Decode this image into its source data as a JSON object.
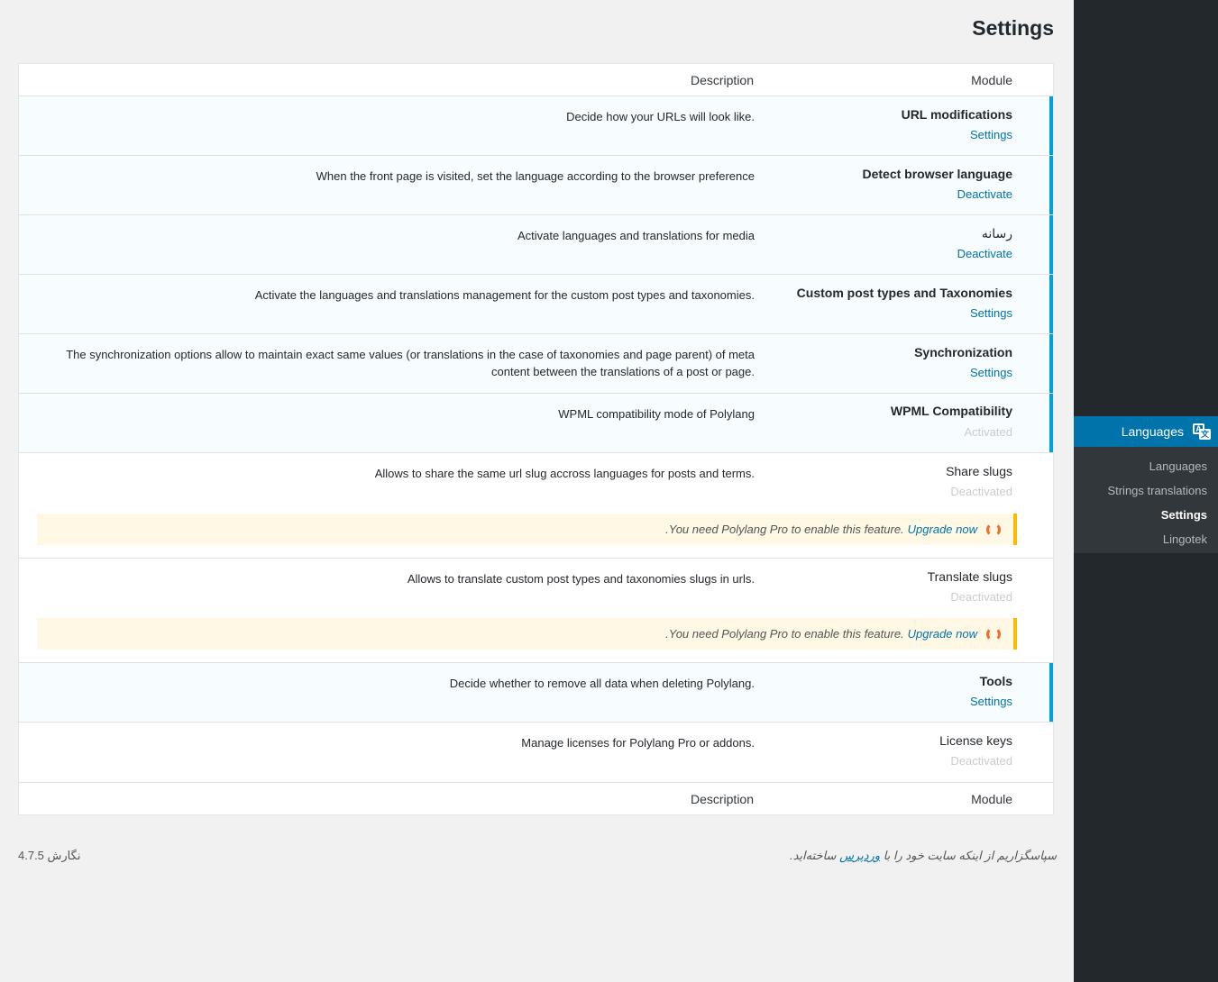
{
  "page": {
    "title": "Settings"
  },
  "table": {
    "header": {
      "module": "Module",
      "description": "Description"
    },
    "rows": [
      {
        "name": "URL modifications",
        "action": "Settings",
        "description": ".Decide how your URLs will look like",
        "active": true
      },
      {
        "name": "Detect browser language",
        "action": "Deactivate",
        "description": "When the front page is visited, set the language according to the browser preference",
        "active": true
      },
      {
        "name": "رسانه",
        "action": "Deactivate",
        "description": "Activate languages and translations for media",
        "active": true
      },
      {
        "name": "Custom post types and Taxonomies",
        "action": "Settings",
        "description": ".Activate the languages and translations management for the custom post types and taxonomies",
        "active": true
      },
      {
        "name": "Synchronization",
        "action": "Settings",
        "description_line1": "The synchronization options allow to maintain exact same values (or translations in the case of taxonomies and page parent) of meta",
        "description_line2": ".content between the translations of a post or page",
        "active": true
      },
      {
        "name": "WPML Compatibility",
        "action": "Activated",
        "description": "WPML compatibility mode of Polylang",
        "active": true
      },
      {
        "name": "Share slugs",
        "action": "Deactivated",
        "description": ".Allows to share the same url slug accross languages for posts and terms",
        "active": false
      },
      {
        "name": "Translate slugs",
        "action": "Deactivated",
        "description": ".Allows to translate custom post types and taxonomies slugs in urls",
        "active": false
      },
      {
        "name": "Tools",
        "action": "Settings",
        "description": ".Decide whether to remove all data when deleting Polylang",
        "active": true
      },
      {
        "name": "License keys",
        "action": "Deactivated",
        "description": ".Manage licenses for Polylang Pro or addons",
        "active": false
      }
    ],
    "notice": {
      "text": ".You need Polylang Pro to enable this feature.",
      "link": "Upgrade now"
    }
  },
  "sidebar": {
    "menu_label": "Languages",
    "items": [
      "Languages",
      "Strings translations",
      "Settings",
      "Lingotek"
    ]
  },
  "footer": {
    "thanks_before": "سپاسگزاریم از اینکه سایت خود را با",
    "thanks_link": "وردپرس",
    "thanks_after": "ساخته‌اید.",
    "version": "نگارش 4.7.5"
  },
  "colors": {
    "accent": "#0073aa",
    "active_border": "#00a0d2",
    "notice_border": "#ffb900",
    "icon": "#f56e28"
  }
}
